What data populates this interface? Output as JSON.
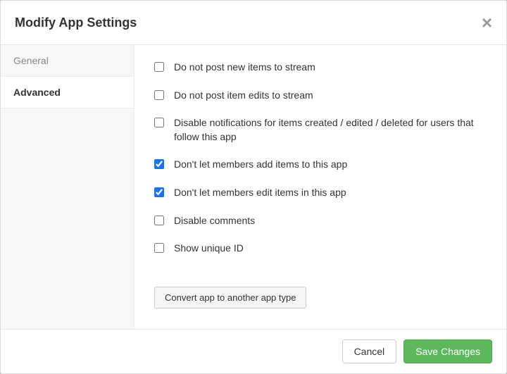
{
  "modal": {
    "title": "Modify App Settings"
  },
  "sidebar": {
    "items": [
      {
        "label": "General",
        "active": false
      },
      {
        "label": "Advanced",
        "active": true
      }
    ]
  },
  "options": [
    {
      "label": "Do not post new items to stream",
      "checked": false
    },
    {
      "label": "Do not post item edits to stream",
      "checked": false
    },
    {
      "label": "Disable notifications for items created / edited / deleted for users that follow this app",
      "checked": false
    },
    {
      "label": "Don't let members add items to this app",
      "checked": true
    },
    {
      "label": "Don't let members edit items in this app",
      "checked": true
    },
    {
      "label": "Disable comments",
      "checked": false
    },
    {
      "label": "Show unique ID",
      "checked": false
    }
  ],
  "buttons": {
    "convert": "Convert app to another app type",
    "cancel": "Cancel",
    "save": "Save Changes"
  }
}
